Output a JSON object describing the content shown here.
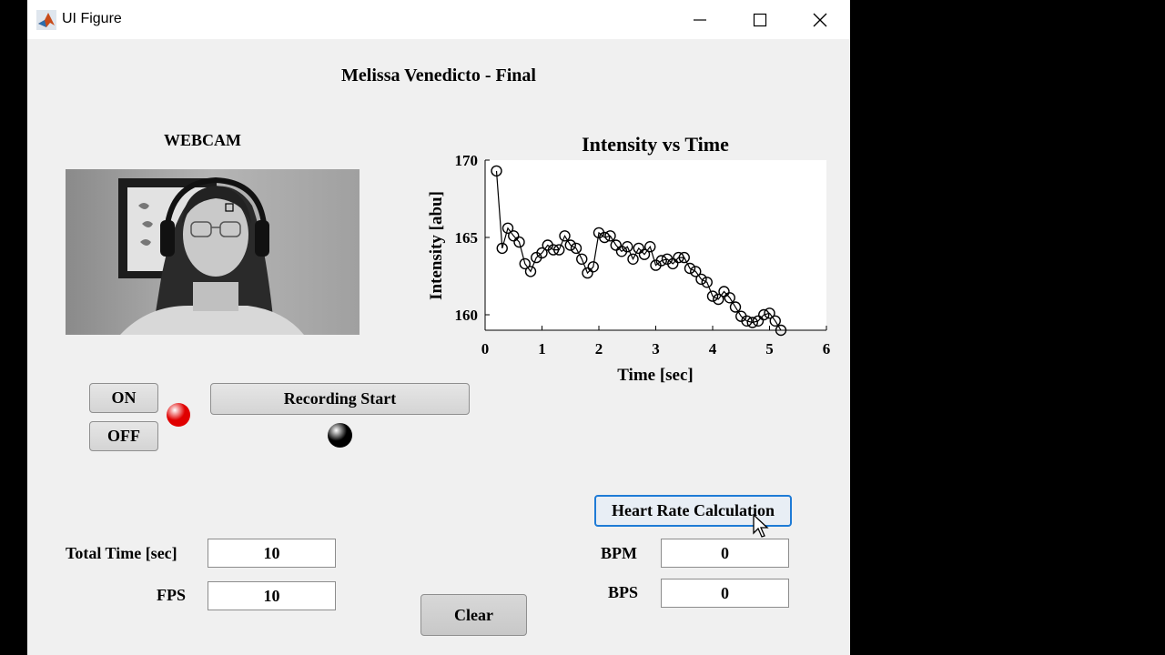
{
  "window": {
    "title": "UI Figure"
  },
  "header": {
    "title": "Melissa Venedicto - Final"
  },
  "webcam": {
    "label": "WEBCAM"
  },
  "controls": {
    "on_label": "ON",
    "off_label": "OFF",
    "record_label": "Recording Start",
    "power_lamp_color": "#e00000",
    "record_lamp_color": "#000000"
  },
  "inputs": {
    "total_time_label": "Total Time [sec]",
    "total_time_value": "10",
    "fps_label": "FPS",
    "fps_value": "10"
  },
  "clear_label": "Clear",
  "heart": {
    "button_label": "Heart Rate Calculation",
    "bpm_label": "BPM",
    "bpm_value": "0",
    "bps_label": "BPS",
    "bps_value": "0"
  },
  "chart_data": {
    "type": "line",
    "title": "Intensity vs Time",
    "xlabel": "Time [sec]",
    "ylabel": "Intensity [abu]",
    "xlim": [
      0,
      6
    ],
    "ylim": [
      159,
      170
    ],
    "xticks": [
      "0",
      "1",
      "2",
      "3",
      "4",
      "5",
      "6"
    ],
    "yticks": [
      "160",
      "165",
      "170"
    ],
    "grid": false,
    "marker": "circle",
    "x": [
      0.2,
      0.3,
      0.4,
      0.5,
      0.6,
      0.7,
      0.8,
      0.9,
      1.0,
      1.1,
      1.2,
      1.3,
      1.4,
      1.5,
      1.6,
      1.7,
      1.8,
      1.9,
      2.0,
      2.1,
      2.2,
      2.3,
      2.4,
      2.5,
      2.6,
      2.7,
      2.8,
      2.9,
      3.0,
      3.1,
      3.2,
      3.3,
      3.4,
      3.5,
      3.6,
      3.7,
      3.8,
      3.9,
      4.0,
      4.1,
      4.2,
      4.3,
      4.4,
      4.5,
      4.6,
      4.7,
      4.8,
      4.9,
      5.0,
      5.1,
      5.2
    ],
    "y": [
      169.3,
      164.3,
      165.6,
      165.1,
      164.7,
      163.3,
      162.8,
      163.7,
      164.0,
      164.5,
      164.2,
      164.2,
      165.1,
      164.5,
      164.3,
      163.6,
      162.7,
      163.1,
      165.3,
      165.0,
      165.1,
      164.5,
      164.1,
      164.4,
      163.6,
      164.3,
      163.9,
      164.4,
      163.2,
      163.5,
      163.6,
      163.3,
      163.7,
      163.7,
      163.0,
      162.8,
      162.3,
      162.1,
      161.2,
      161.0,
      161.5,
      161.1,
      160.5,
      159.9,
      159.6,
      159.5,
      159.6,
      160.0,
      160.1,
      159.6,
      159.0
    ]
  }
}
